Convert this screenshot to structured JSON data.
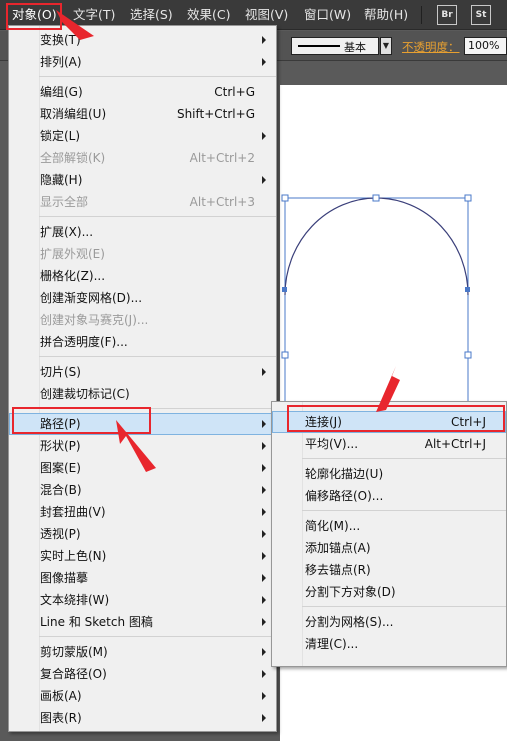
{
  "menubar": {
    "items": [
      "对象(O)",
      "文字(T)",
      "选择(S)",
      "效果(C)",
      "视图(V)",
      "窗口(W)",
      "帮助(H)"
    ],
    "app_icons": [
      "Br",
      "St"
    ]
  },
  "controlbar": {
    "stroke_style_label": "基本",
    "opacity_label": "不透明度：",
    "opacity_value": "100%"
  },
  "object_menu": {
    "items": [
      {
        "label": "变换(T)",
        "shortcut": "",
        "submenu": true,
        "enabled": true
      },
      {
        "label": "排列(A)",
        "shortcut": "",
        "submenu": true,
        "enabled": true
      },
      {
        "label": "编组(G)",
        "shortcut": "Ctrl+G",
        "submenu": false,
        "enabled": true
      },
      {
        "label": "取消编组(U)",
        "shortcut": "Shift+Ctrl+G",
        "submenu": false,
        "enabled": true
      },
      {
        "label": "锁定(L)",
        "shortcut": "",
        "submenu": true,
        "enabled": true
      },
      {
        "label": "全部解锁(K)",
        "shortcut": "Alt+Ctrl+2",
        "submenu": false,
        "enabled": false
      },
      {
        "label": "隐藏(H)",
        "shortcut": "",
        "submenu": true,
        "enabled": true
      },
      {
        "label": "显示全部",
        "shortcut": "Alt+Ctrl+3",
        "submenu": false,
        "enabled": false
      },
      {
        "label": "扩展(X)...",
        "shortcut": "",
        "submenu": false,
        "enabled": true
      },
      {
        "label": "扩展外观(E)",
        "shortcut": "",
        "submenu": false,
        "enabled": false
      },
      {
        "label": "栅格化(Z)...",
        "shortcut": "",
        "submenu": false,
        "enabled": true
      },
      {
        "label": "创建渐变网格(D)...",
        "shortcut": "",
        "submenu": false,
        "enabled": true
      },
      {
        "label": "创建对象马赛克(J)...",
        "shortcut": "",
        "submenu": false,
        "enabled": false
      },
      {
        "label": "拼合透明度(F)...",
        "shortcut": "",
        "submenu": false,
        "enabled": true
      },
      {
        "label": "切片(S)",
        "shortcut": "",
        "submenu": true,
        "enabled": true
      },
      {
        "label": "创建裁切标记(C)",
        "shortcut": "",
        "submenu": false,
        "enabled": true
      },
      {
        "label": "路径(P)",
        "shortcut": "",
        "submenu": true,
        "enabled": true
      },
      {
        "label": "形状(P)",
        "shortcut": "",
        "submenu": true,
        "enabled": true
      },
      {
        "label": "图案(E)",
        "shortcut": "",
        "submenu": true,
        "enabled": true
      },
      {
        "label": "混合(B)",
        "shortcut": "",
        "submenu": true,
        "enabled": true
      },
      {
        "label": "封套扭曲(V)",
        "shortcut": "",
        "submenu": true,
        "enabled": true
      },
      {
        "label": "透视(P)",
        "shortcut": "",
        "submenu": true,
        "enabled": true
      },
      {
        "label": "实时上色(N)",
        "shortcut": "",
        "submenu": true,
        "enabled": true
      },
      {
        "label": "图像描摹",
        "shortcut": "",
        "submenu": true,
        "enabled": true
      },
      {
        "label": "文本绕排(W)",
        "shortcut": "",
        "submenu": true,
        "enabled": true
      },
      {
        "label": "Line 和 Sketch 图稿",
        "shortcut": "",
        "submenu": true,
        "enabled": true
      },
      {
        "label": "剪切蒙版(M)",
        "shortcut": "",
        "submenu": true,
        "enabled": true
      },
      {
        "label": "复合路径(O)",
        "shortcut": "",
        "submenu": true,
        "enabled": true
      },
      {
        "label": "画板(A)",
        "shortcut": "",
        "submenu": true,
        "enabled": true
      },
      {
        "label": "图表(R)",
        "shortcut": "",
        "submenu": true,
        "enabled": true
      }
    ]
  },
  "path_submenu": {
    "items": [
      {
        "label": "连接(J)",
        "shortcut": "Ctrl+J"
      },
      {
        "label": "平均(V)...",
        "shortcut": "Alt+Ctrl+J"
      },
      {
        "label": "轮廓化描边(U)",
        "shortcut": ""
      },
      {
        "label": "偏移路径(O)...",
        "shortcut": ""
      },
      {
        "label": "简化(M)...",
        "shortcut": ""
      },
      {
        "label": "添加锚点(A)",
        "shortcut": ""
      },
      {
        "label": "移去锚点(R)",
        "shortcut": ""
      },
      {
        "label": "分割下方对象(D)",
        "shortcut": ""
      },
      {
        "label": "分割为网格(S)...",
        "shortcut": ""
      },
      {
        "label": "清理(C)...",
        "shortcut": ""
      }
    ]
  },
  "colors": {
    "annotation_red": "#e8262d",
    "selection_blue": "#4a78c8",
    "highlight": "#cfe4f7"
  }
}
